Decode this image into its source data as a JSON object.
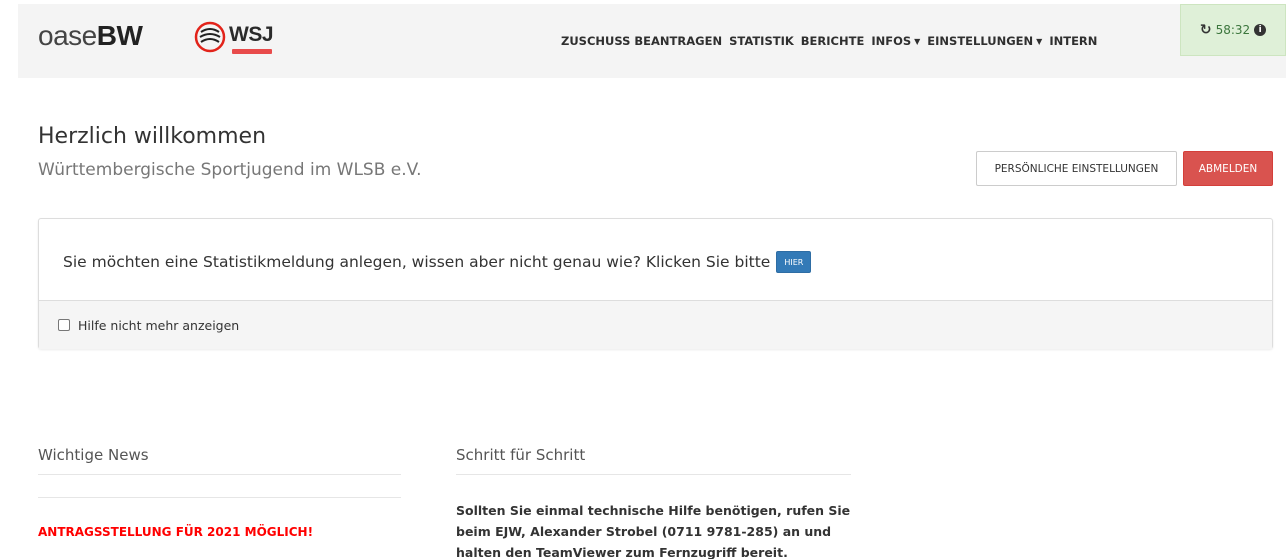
{
  "brand": {
    "light": "oase",
    "bold": "BW",
    "partner_logo_text": "WSJ"
  },
  "nav": {
    "items": [
      {
        "label": "ZUSCHUSS BEANTRAGEN",
        "dropdown": false
      },
      {
        "label": "STATISTIK",
        "dropdown": false
      },
      {
        "label": "BERICHTE",
        "dropdown": false
      },
      {
        "label": "INFOS",
        "dropdown": true
      },
      {
        "label": "EINSTELLUNGEN",
        "dropdown": true
      },
      {
        "label": "INTERN",
        "dropdown": false
      }
    ],
    "caret": "▼"
  },
  "session": {
    "timer": "58:32",
    "refresh_icon": "refresh-icon",
    "info_icon": "info-circle-icon"
  },
  "header": {
    "welcome": "Herzlich willkommen",
    "organization": "Württembergische Sportjugend im WLSB e.V.",
    "settings_button": "PERSÖNLICHE EINSTELLUNGEN",
    "logout_button": "ABMELDEN"
  },
  "help_panel": {
    "text": "Sie möchten eine Statistikmeldung anlegen, wissen aber nicht genau wie? Klicken Sie bitte",
    "link_button": "HIER",
    "dismiss_label": "Hilfe nicht mehr anzeigen"
  },
  "news": {
    "title": "Wichtige News",
    "headline": "ANTRAGSSTELLUNG FÜR 2021 MÖGLICH!"
  },
  "steps": {
    "title": "Schritt für Schritt",
    "help_text": "Sollten Sie einmal technische Hilfe benötigen, rufen Sie beim EJW, Alexander Strobel (0711 9781-285) an und halten den TeamViewer zum Fernzugriff bereit."
  },
  "colors": {
    "navbar_bg": "#f4f4f4",
    "timer_bg": "#dff0d8",
    "logout": "#d9534f",
    "link_button": "#337ab7",
    "news_headline": "#ff0000",
    "logo_red": "#e2231a"
  }
}
